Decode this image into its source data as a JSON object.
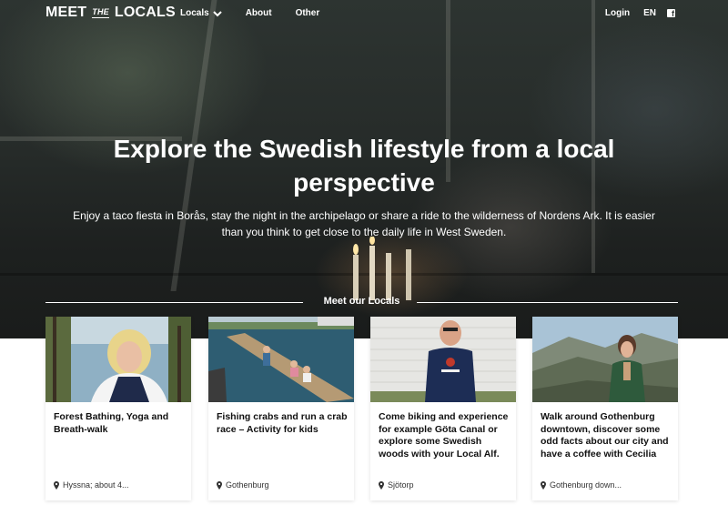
{
  "brand": {
    "logo_left": "MEET",
    "logo_mid": "THE",
    "logo_right": "LOCALS"
  },
  "nav": {
    "items": [
      {
        "label": "Locals",
        "has_dropdown": true
      },
      {
        "label": "About"
      },
      {
        "label": "Other"
      }
    ],
    "login": "Login",
    "language": "EN",
    "social_icon": "facebook-icon"
  },
  "hero": {
    "title": "Explore the Swedish lifestyle from a local perspective",
    "subtitle": "Enjoy a taco fiesta in Borås, stay the night in the archipelago or share a ride to the wilderness of Nordens Ark. It is easier than you think to get close to the daily life in West Sweden."
  },
  "section": {
    "title": "Meet our Locals"
  },
  "cards": [
    {
      "title": "Forest Bathing, Yoga and Breath-walk",
      "location": "Hyssna; about 4..."
    },
    {
      "title": "Fishing crabs and run a crab race – Activity for kids",
      "location": "Gothenburg"
    },
    {
      "title": "Come biking and experience for example Göta Canal or explore some Swedish woods with your Local Alf.",
      "location": "Sjötorp"
    },
    {
      "title": "Walk around Gothenburg downtown, discover some odd facts about our city and have a coffee with Cecilia",
      "location": "Gothenburg down..."
    }
  ],
  "theme": {
    "hero_bg": "#262b29",
    "text_on_dark": "#ffffff",
    "card_bg": "#ffffff",
    "body_text": "#111111"
  }
}
